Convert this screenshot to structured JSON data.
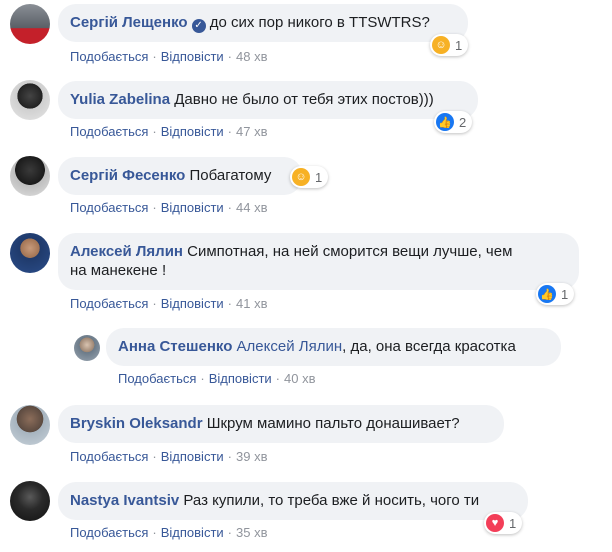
{
  "actions": {
    "like": "Подобається",
    "reply": "Відповісти"
  },
  "comments": [
    {
      "author": "Сергій Лещенко",
      "verified": true,
      "text": "до сих пор никого в TTSWTRS?",
      "time": "48 хв",
      "reaction": {
        "type": "haha",
        "count": "1"
      }
    },
    {
      "author": "Yulia Zabelina",
      "text": "Давно не было от тебя этих постов)))",
      "time": "47 хв",
      "reaction": {
        "type": "like",
        "count": "2"
      }
    },
    {
      "author": "Сергій Фесенко",
      "text": "Побагатому",
      "time": "44 хв",
      "reaction": {
        "type": "haha",
        "count": "1"
      }
    },
    {
      "author": "Алексей Лялин",
      "text_line1": "Симпотная, на ней сморится вещи лучше, чем",
      "text_line2": "на манекене !",
      "time": "41 хв",
      "reaction": {
        "type": "like",
        "count": "1"
      }
    },
    {
      "author": "Анна Стешенко",
      "tag": "Алексей Лялин",
      "text": ", да, она всегда красотка",
      "time": "40 хв"
    },
    {
      "author": "Bryskin Oleksandr",
      "text": "Шкрум мамино пальто донашивает?",
      "time": "39 хв"
    },
    {
      "author": "Nastya Ivantsiv",
      "text": "Раз купили, то треба вже й носить, чого ти",
      "time": "35 хв",
      "reaction": {
        "type": "love",
        "count": "1"
      }
    }
  ]
}
